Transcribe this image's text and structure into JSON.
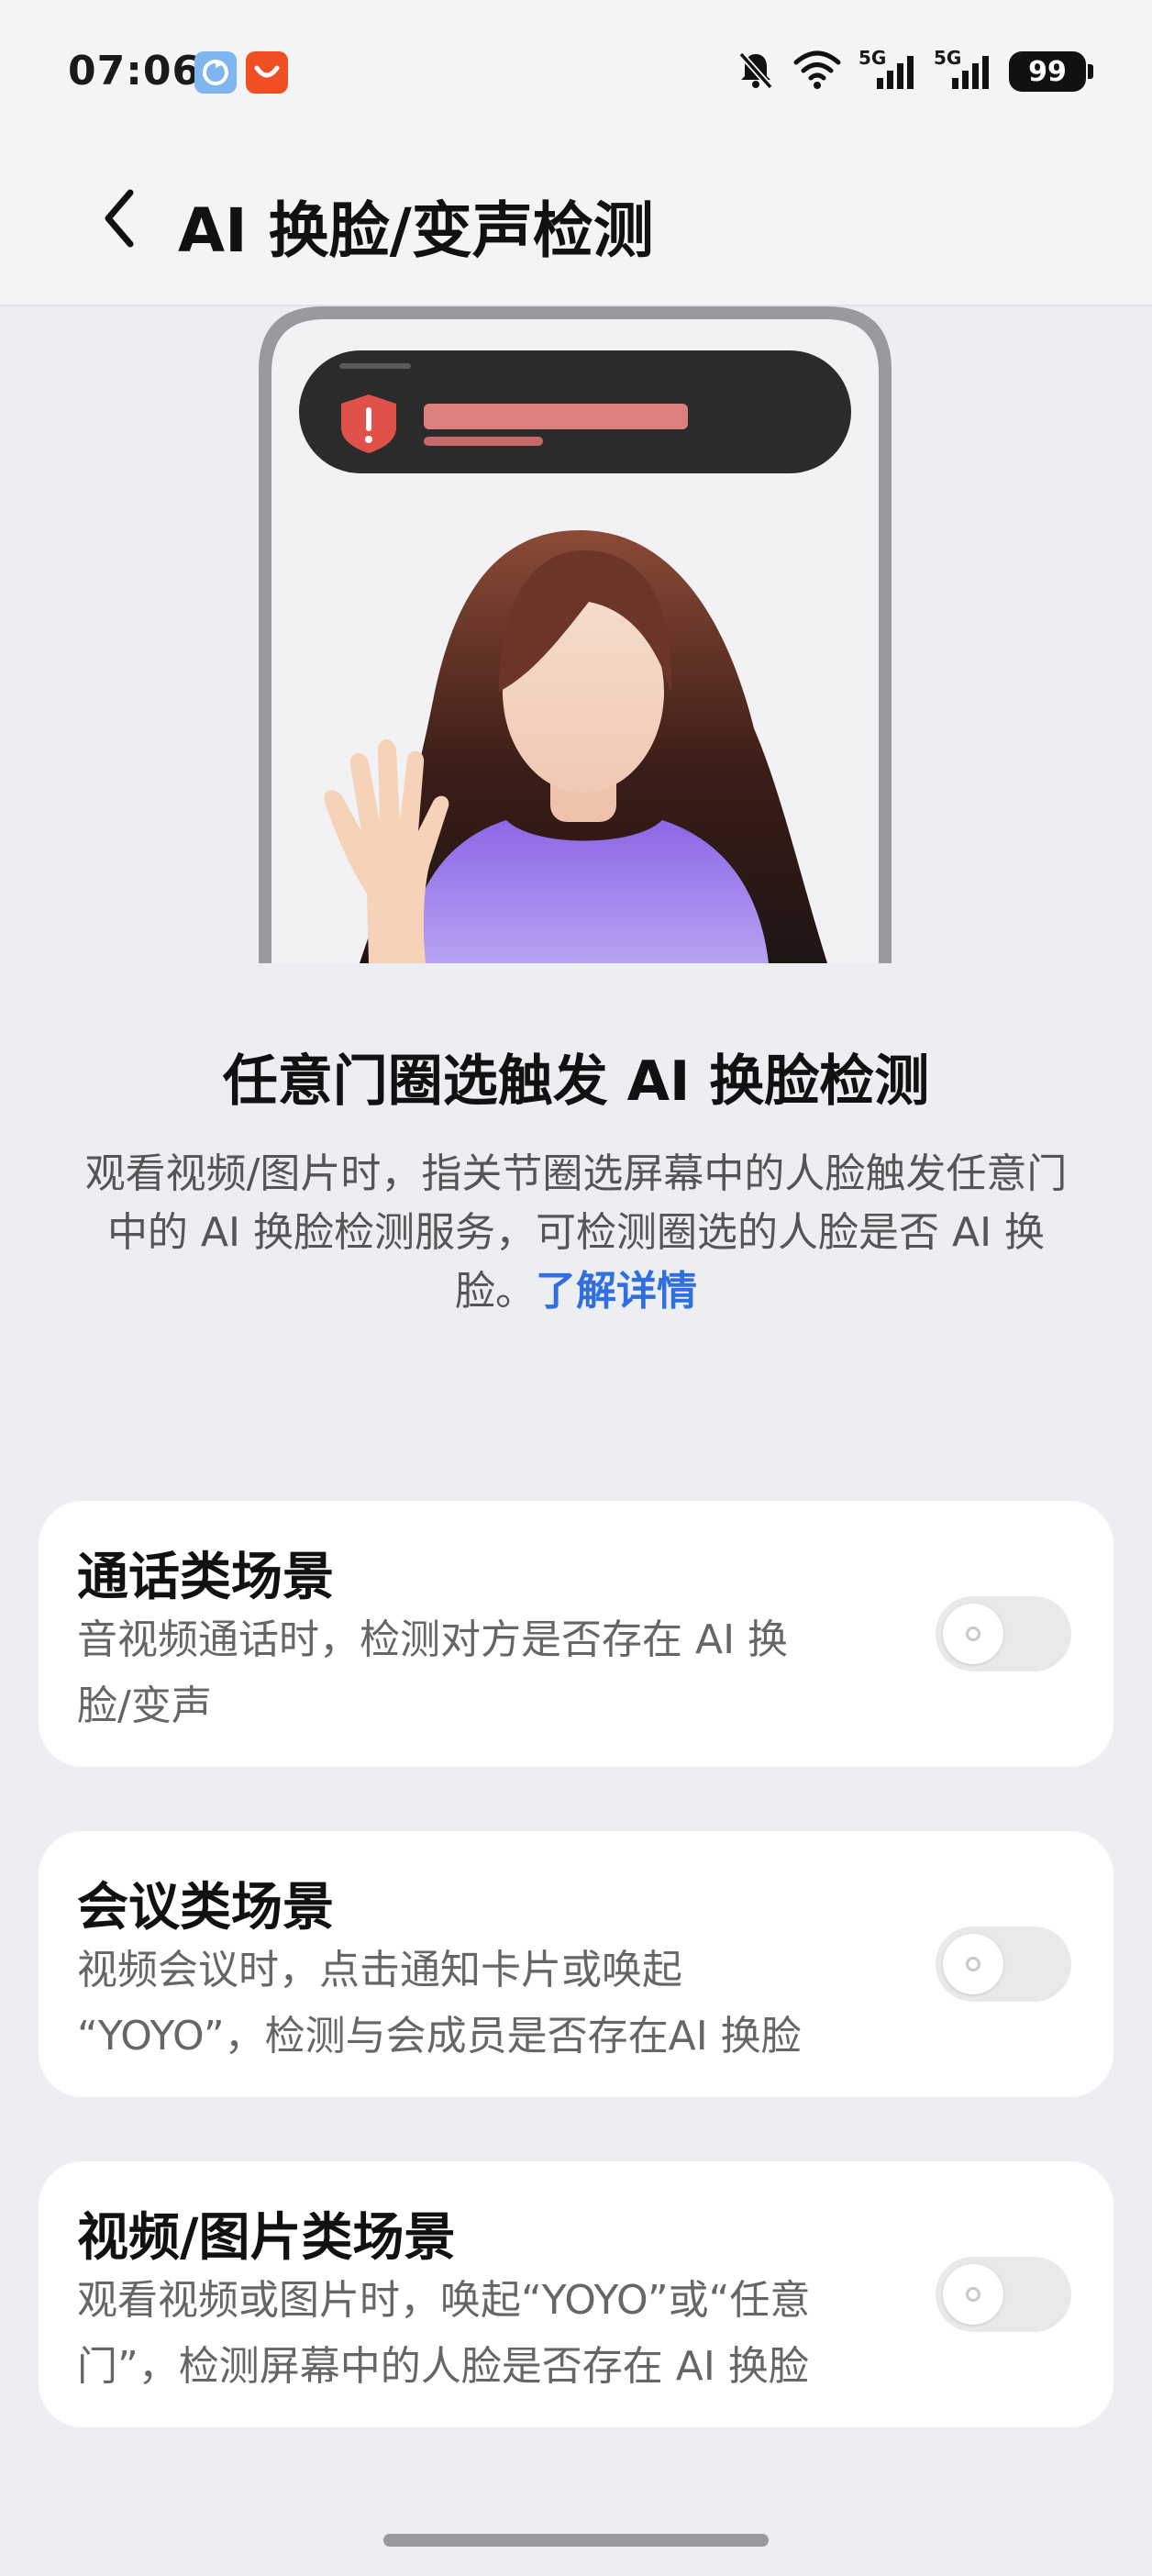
{
  "status_bar": {
    "time": "07:06",
    "battery": "99",
    "network_1": "5G",
    "network_2": "5G",
    "icons": [
      "app-sync-icon",
      "app-shopping-icon",
      "bell-muted-icon",
      "wifi-icon",
      "signal-5g-icon",
      "signal-5g-icon",
      "battery-icon"
    ]
  },
  "header": {
    "title": "AI 换脸/变声检测",
    "back_icon": "chevron-left-icon"
  },
  "intro": {
    "title": "任意门圈选触发 AI 换脸检测",
    "description": "观看视频/图片时，指关节圈选屏幕中的人脸触发任意门中的 AI 换脸检测服务，可检测圈选的人脸是否 AI 换脸。",
    "learn_more": "了解详情"
  },
  "cards": [
    {
      "title": "通话类场景",
      "desc_line1": "音视频通话时，检测对方是否存在 AI 换",
      "desc_line2": "脸/变声",
      "enabled": false
    },
    {
      "title": "会议类场景",
      "desc_line1": "视频会议时，点击通知卡片或唤起",
      "desc_line2": "“YOYO”，检测与会成员是否存在AI 换脸",
      "enabled": false
    },
    {
      "title": "视频/图片类场景",
      "desc_line1": "观看视频或图片时，唤起“YOYO”或“任意",
      "desc_line2": "门”，检测屏幕中的人脸是否存在 AI 换脸",
      "enabled": false
    }
  ],
  "colors": {
    "accent": "#2F6FE0",
    "background": "#EDEEF2",
    "card": "#FFFFFF",
    "toggle_off": "#E9E9EB",
    "alert_red": "#E0514A"
  }
}
